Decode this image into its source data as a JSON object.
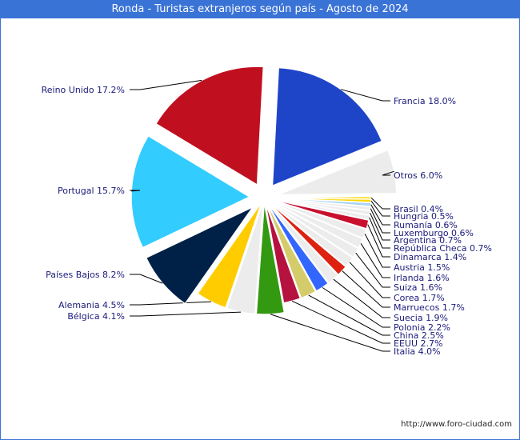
{
  "title": "Ronda - Turistas extranjeros según país - Agosto de 2024",
  "footer": "http://www.foro-ciudad.com",
  "chart_data": {
    "type": "pie",
    "title": "Ronda - Turistas extranjeros según país - Agosto de 2024",
    "unit": "%",
    "slices": [
      {
        "label": "Francia",
        "value": 18.0,
        "color": "#1e44c8",
        "exploded": true
      },
      {
        "label": "Otros",
        "value": 6.0,
        "color": "#ececec",
        "exploded": true
      },
      {
        "label": "Brasil",
        "value": 0.4,
        "color": "#ffd700"
      },
      {
        "label": "Hungria",
        "value": 0.5,
        "color": "#ffd700"
      },
      {
        "label": "Rumanía",
        "value": 0.6,
        "color": "#aad4f5"
      },
      {
        "label": "Luxemburgo",
        "value": 0.6,
        "color": "#ececec"
      },
      {
        "label": "Argentina",
        "value": 0.7,
        "color": "#ececec"
      },
      {
        "label": "República Checa",
        "value": 0.7,
        "color": "#ececec"
      },
      {
        "label": "Dinamarca",
        "value": 1.4,
        "color": "#c8102e"
      },
      {
        "label": "Austria",
        "value": 1.5,
        "color": "#ececec"
      },
      {
        "label": "Irlanda",
        "value": 1.6,
        "color": "#ececec"
      },
      {
        "label": "Suiza",
        "value": 1.6,
        "color": "#ececec"
      },
      {
        "label": "Corea",
        "value": 1.7,
        "color": "#ececec"
      },
      {
        "label": "Marruecos",
        "value": 1.7,
        "color": "#dd2211"
      },
      {
        "label": "Suecia",
        "value": 1.9,
        "color": "#ececec"
      },
      {
        "label": "Polonia",
        "value": 2.2,
        "color": "#3366ff"
      },
      {
        "label": "China",
        "value": 2.5,
        "color": "#d4cc6a"
      },
      {
        "label": "EEUU",
        "value": 2.7,
        "color": "#b5123f"
      },
      {
        "label": "Italia",
        "value": 4.0,
        "color": "#339911"
      },
      {
        "label": "Bélgica",
        "value": 4.1,
        "color": "#ececec"
      },
      {
        "label": "Alemania",
        "value": 4.5,
        "color": "#ffcc00"
      },
      {
        "label": "Países Bajos",
        "value": 8.2,
        "color": "#002147",
        "exploded": true
      },
      {
        "label": "Portugal",
        "value": 15.7,
        "color": "#33ccff",
        "exploded": true
      },
      {
        "label": "Reino Unido",
        "value": 17.2,
        "color": "#c01020",
        "exploded": true
      }
    ]
  }
}
